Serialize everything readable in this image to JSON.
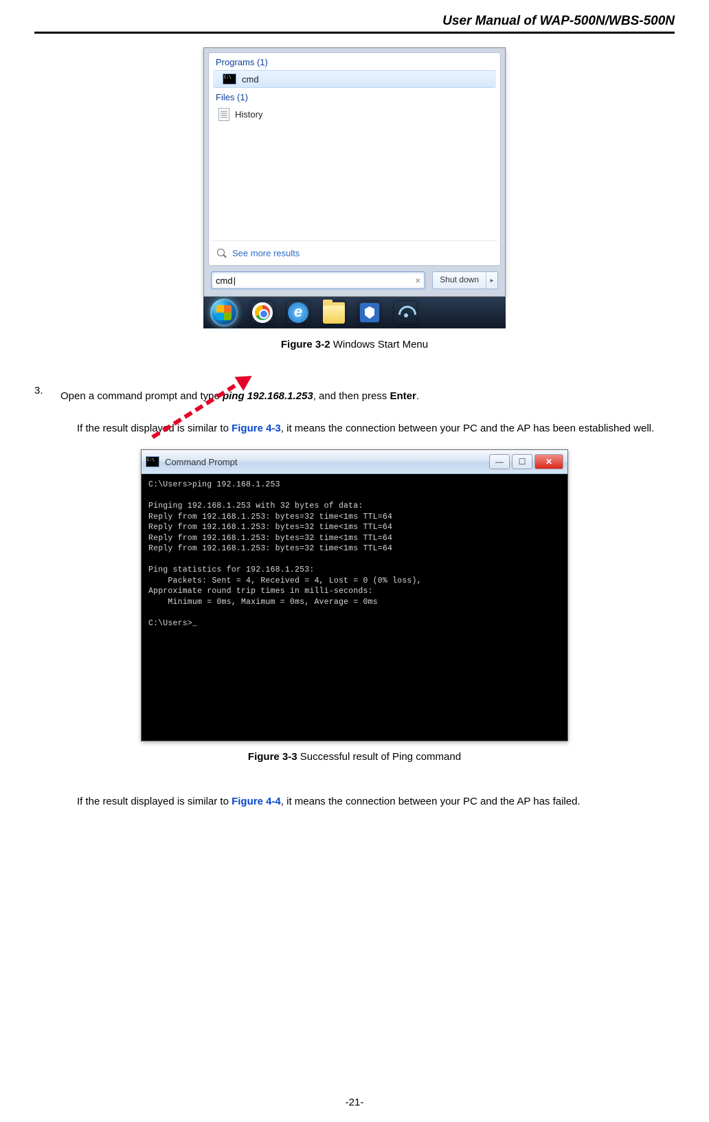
{
  "header": {
    "title": "User  Manual  of  WAP-500N/WBS-500N"
  },
  "start_menu": {
    "programs_label": "Programs (1)",
    "cmd_label": "cmd",
    "files_label": "Files (1)",
    "history_label": "History",
    "see_more": "See more results",
    "search_value": "cmd",
    "shutdown_label": "Shut down",
    "shutdown_arrow": "▸"
  },
  "figure1": {
    "label": "Figure 3-2",
    "desc": " Windows Start Menu"
  },
  "step3": {
    "num": "3.",
    "line1a": "Open a command prompt and type ",
    "line1b": "ping 192.168.1.253",
    "line1c": ", and then press ",
    "line1d": "Enter",
    "line1e": "."
  },
  "para1a": "If the result displayed is similar to ",
  "para1_link": "Figure 4-3",
  "para1b": ", it means the connection between your PC and the AP has been established well.",
  "cmd": {
    "title": "Command Prompt",
    "body": "C:\\Users>ping 192.168.1.253\n\nPinging 192.168.1.253 with 32 bytes of data:\nReply from 192.168.1.253: bytes=32 time<1ms TTL=64\nReply from 192.168.1.253: bytes=32 time<1ms TTL=64\nReply from 192.168.1.253: bytes=32 time<1ms TTL=64\nReply from 192.168.1.253: bytes=32 time<1ms TTL=64\n\nPing statistics for 192.168.1.253:\n    Packets: Sent = 4, Received = 4, Lost = 0 (0% loss),\nApproximate round trip times in milli-seconds:\n    Minimum = 0ms, Maximum = 0ms, Average = 0ms\n\nC:\\Users>_"
  },
  "figure2": {
    "label": "Figure 3-3",
    "desc": " Successful result of Ping command"
  },
  "para2a": "If the result displayed is similar to ",
  "para2_link": "Figure 4-4",
  "para2b": ", it means the connection between your PC and the AP has failed.",
  "page_number": "-21-"
}
